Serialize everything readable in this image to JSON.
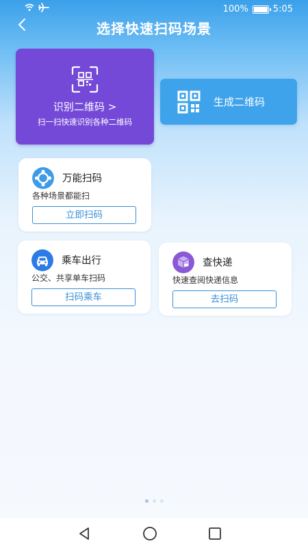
{
  "status_bar": {
    "battery_percent": "100%",
    "time": "5:05",
    "icons": [
      "wifi-icon",
      "airplane-icon",
      "battery-icon"
    ]
  },
  "header": {
    "back_icon": "back-arrow-icon",
    "title": "选择快速扫码场景"
  },
  "recognize_card": {
    "icon": "qr-scan-icon",
    "title": "识别二维码 >",
    "subtitle": "扫一扫快速识别各种二维码",
    "color": "#7449d8"
  },
  "generate_card": {
    "icon": "qr-code-icon",
    "label": "生成二维码",
    "color": "#3ea3ea"
  },
  "scenes": [
    {
      "icon": "universal-scan-icon",
      "title": "万能扫码",
      "desc": "各种场景都能扫",
      "button": "立即扫码",
      "icon_color": "#3d9be8"
    },
    {
      "icon": "car-icon",
      "title": "乘车出行",
      "desc": "公交、共享单车扫码",
      "button": "扫码乘车",
      "icon_color": "#2c7be6"
    },
    {
      "icon": "package-icon",
      "title": "查快递",
      "desc": "快速查阅快递信息",
      "button": "去扫码",
      "icon_color": "#8a59d6"
    }
  ],
  "accent_color": "#3a8fd6",
  "nav": {
    "icons": [
      "back-triangle-icon",
      "home-circle-icon",
      "recents-square-icon"
    ]
  }
}
